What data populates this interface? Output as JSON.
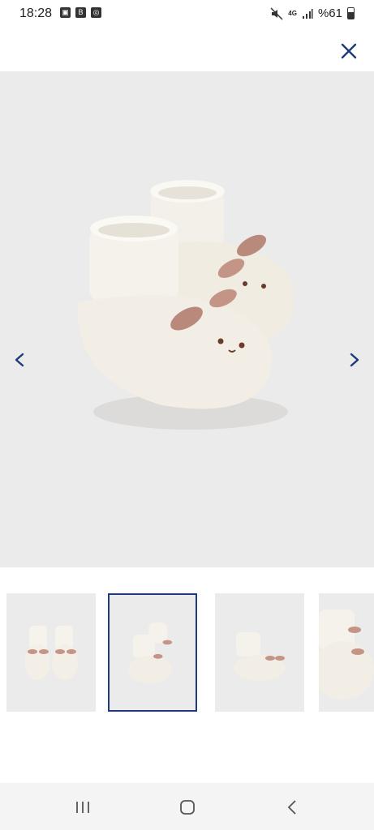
{
  "status_bar": {
    "time": "18:28",
    "network": "4G",
    "battery": "%61",
    "left_icons": [
      "image-icon",
      "b-icon",
      "instagram-icon"
    ],
    "right_icons": [
      "mute-icon",
      "signal-icon",
      "battery-icon"
    ]
  },
  "header": {
    "close_icon": "close-icon"
  },
  "gallery": {
    "prev_icon": "chevron-left-icon",
    "next_icon": "chevron-right-icon",
    "accent_color": "#1f3a7a",
    "thumbnails_count": 4,
    "selected_thumbnail": 2
  },
  "system_nav": {
    "recent_icon": "recent-apps-icon",
    "home_icon": "home-icon",
    "back_icon": "back-icon"
  }
}
